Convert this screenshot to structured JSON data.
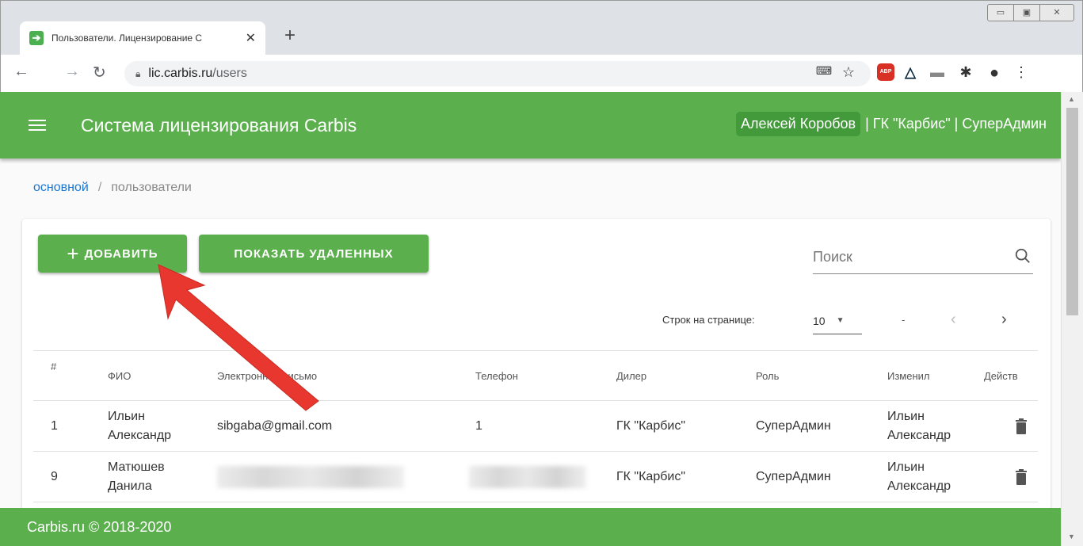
{
  "browser": {
    "tab_title": "Пользователи. Лицензирование С",
    "url_host": "lic.carbis.ru",
    "url_path": "/users",
    "favicon_text": "➔",
    "abp_label": "ABP"
  },
  "header": {
    "title": "Система лицензирования Carbis",
    "user_name": "Алексей Коробов",
    "user_rest": "| ГК \"Карбис\" | СуперАдмин"
  },
  "breadcrumb": {
    "home": "основной",
    "separator": "/",
    "current": "пользователи"
  },
  "toolbar": {
    "add_label": "ДОБАВИТЬ",
    "show_deleted_label": "ПОКАЗАТЬ УДАЛЕННЫХ",
    "search_placeholder": "Поиск"
  },
  "pagination": {
    "rows_label": "Строк на странице:",
    "rows_value": "10",
    "range": "-"
  },
  "table": {
    "headers": {
      "num": "#",
      "fio": "ФИО",
      "email": "Электронное письмо",
      "phone": "Телефон",
      "dealer": "Дилер",
      "role": "Роль",
      "changed": "Изменил",
      "actions": "Действ"
    },
    "rows": [
      {
        "num": "1",
        "fio": "Ильин Александр",
        "email": "sibgaba@gmail.com",
        "phone": "1",
        "dealer": "ГК \"Карбис\"",
        "role": "СуперАдмин",
        "changed": "Ильин Александр"
      },
      {
        "num": "9",
        "fio": "Матюшев Данила",
        "email": "",
        "phone": "",
        "dealer": "ГК \"Карбис\"",
        "role": "СуперАдмин",
        "changed": "Ильин Александр"
      }
    ]
  },
  "footer": {
    "text": "Carbis.ru © 2018-2020"
  },
  "colors": {
    "brand_green": "#5bb04d",
    "link_blue": "#1976d2",
    "annotation_arrow": "#e8372f"
  }
}
